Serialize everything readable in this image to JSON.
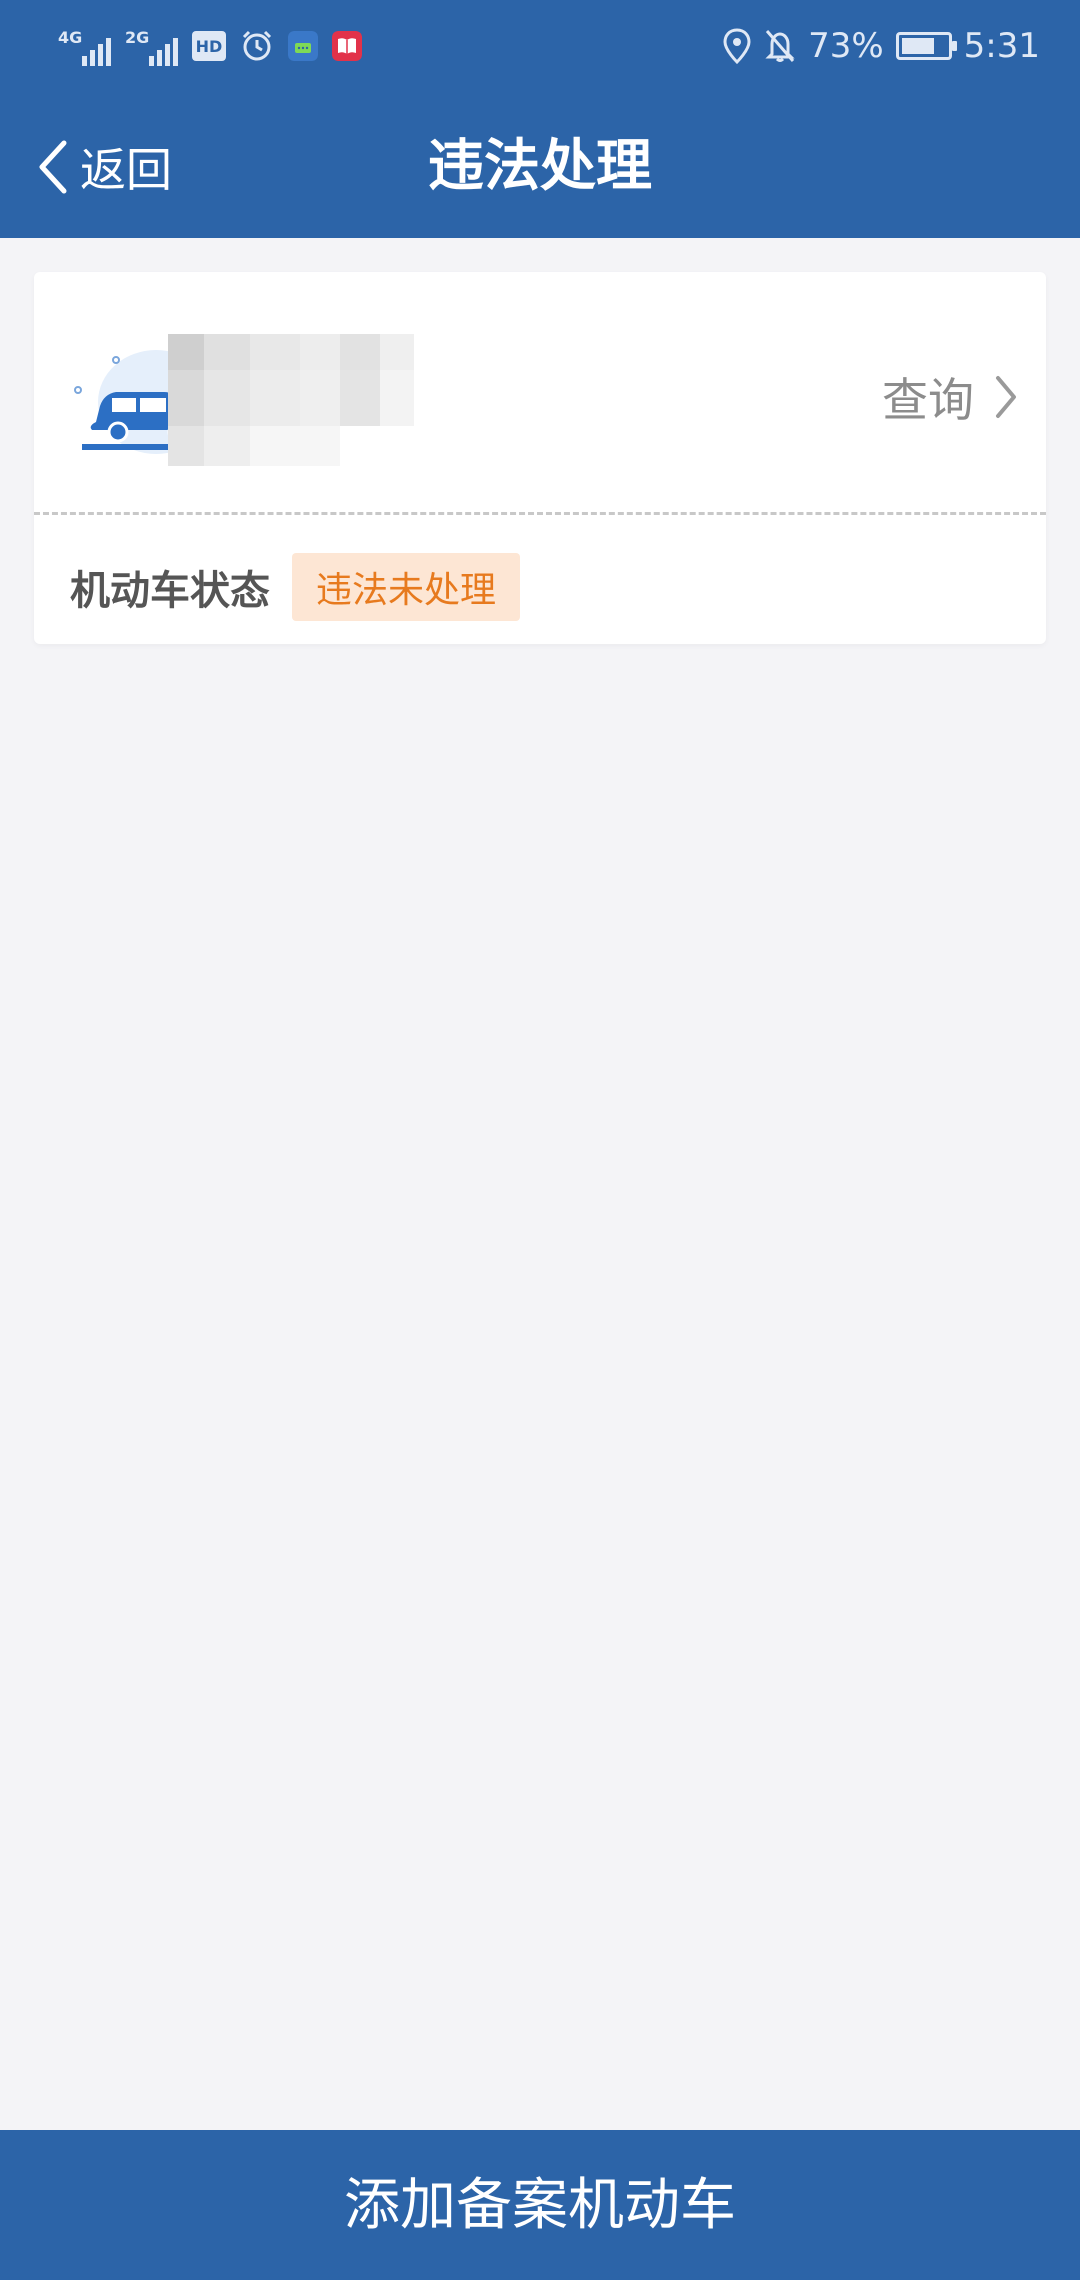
{
  "status_bar": {
    "network1": "4G",
    "network2": "2G",
    "hd": "HD",
    "battery_percent": "73%",
    "battery_level": 0.73,
    "time": "5:31",
    "icons": [
      "signal-icon",
      "alarm-icon",
      "message-app-icon",
      "book-app-icon",
      "location-icon",
      "bell-off-icon",
      "battery-icon"
    ]
  },
  "nav": {
    "back_label": "返回",
    "title": "违法处理"
  },
  "vehicle_card": {
    "query_label": "查询",
    "status_label": "机动车状态",
    "status_badge": "违法未处理"
  },
  "bottom": {
    "add_button_label": "添加备案机动车"
  },
  "colors": {
    "primary": "#2c64a8",
    "background": "#f4f4f7",
    "badge_bg": "#fde6d4",
    "badge_text": "#e77a1e"
  }
}
